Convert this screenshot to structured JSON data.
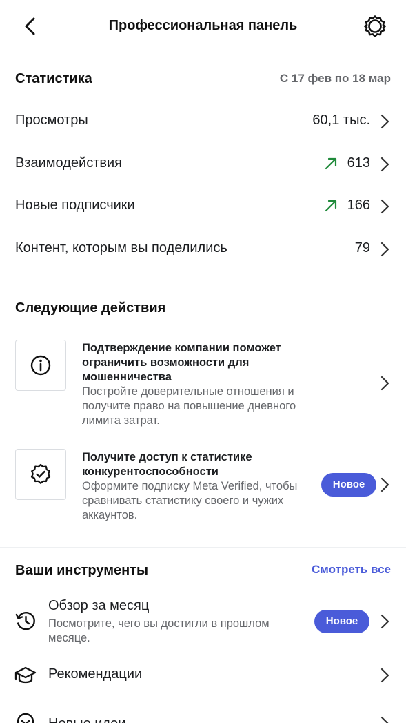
{
  "header": {
    "title": "Профессиональная панель",
    "back_icon": "chevron-left-icon",
    "settings_icon": "gear-icon"
  },
  "stats": {
    "title": "Статистика",
    "range": "С 17 фев по 18 мар",
    "rows": [
      {
        "label": "Просмотры",
        "value": "60,1 тыс.",
        "trend": ""
      },
      {
        "label": "Взаимодействия",
        "value": "613",
        "trend": "up"
      },
      {
        "label": "Новые подписчики",
        "value": "166",
        "trend": "up"
      },
      {
        "label": "Контент, которым вы поделились",
        "value": "79",
        "trend": ""
      }
    ]
  },
  "next_actions": {
    "title": "Следующие действия",
    "items": [
      {
        "icon": "info-icon",
        "title": "Подтверждение компании поможет ограничить возможности для мошенничества",
        "description": "Постройте доверительные отношения и получите право на повышение дневного лимита затрат.",
        "badge": ""
      },
      {
        "icon": "verified-badge-icon",
        "title": "Получите доступ к статистике конкурентоспособности",
        "description": "Оформите подписку Meta Verified, чтобы сравнивать статистику своего и чужих аккаунтов.",
        "badge": "Новое"
      }
    ]
  },
  "tools": {
    "title": "Ваши инструменты",
    "see_all": "Смотреть все",
    "items": [
      {
        "icon": "history-icon",
        "title": "Обзор за месяц",
        "description": "Посмотрите, чего вы достигли в прошлом месяце.",
        "badge": "Новое"
      },
      {
        "icon": "graduation-cap-icon",
        "title": "Рекомендации",
        "description": "",
        "badge": ""
      },
      {
        "icon": "lightbulb-icon",
        "title": "Новые идеи",
        "description": "",
        "badge": ""
      }
    ]
  },
  "colors": {
    "accent": "#4a5bd9",
    "trend_up": "#1f8a3a",
    "secondary_text": "#65676b"
  }
}
